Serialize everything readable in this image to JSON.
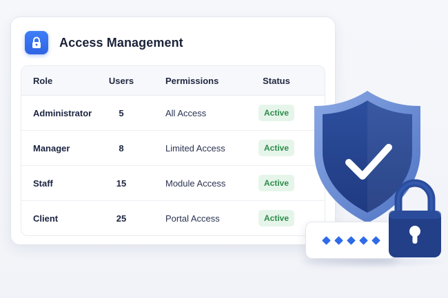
{
  "card": {
    "title": "Access Management",
    "icon": "lock-icon"
  },
  "table": {
    "headers": {
      "role": "Role",
      "users": "Users",
      "permissions": "Permissions",
      "status": "Status"
    },
    "rows": [
      {
        "role": "Administrator",
        "users": "5",
        "permissions": "All Access",
        "status": "Active"
      },
      {
        "role": "Manager",
        "users": "8",
        "permissions": "Limited Access",
        "status": "Active"
      },
      {
        "role": "Staff",
        "users": "15",
        "permissions": "Module Access",
        "status": "Active"
      },
      {
        "role": "Client",
        "users": "25",
        "permissions": "Portal Access",
        "status": "Active"
      }
    ]
  },
  "illustration": {
    "shield_icon": "shield-check-icon",
    "padlock_icon": "padlock-icon",
    "password_mask": "password-dots"
  },
  "colors": {
    "accent": "#2f64e3",
    "shield_dark": "#233f86",
    "shield_light": "#6f92d8",
    "active_badge_bg": "#e6f5ea",
    "active_badge_text": "#2e8b4a"
  }
}
